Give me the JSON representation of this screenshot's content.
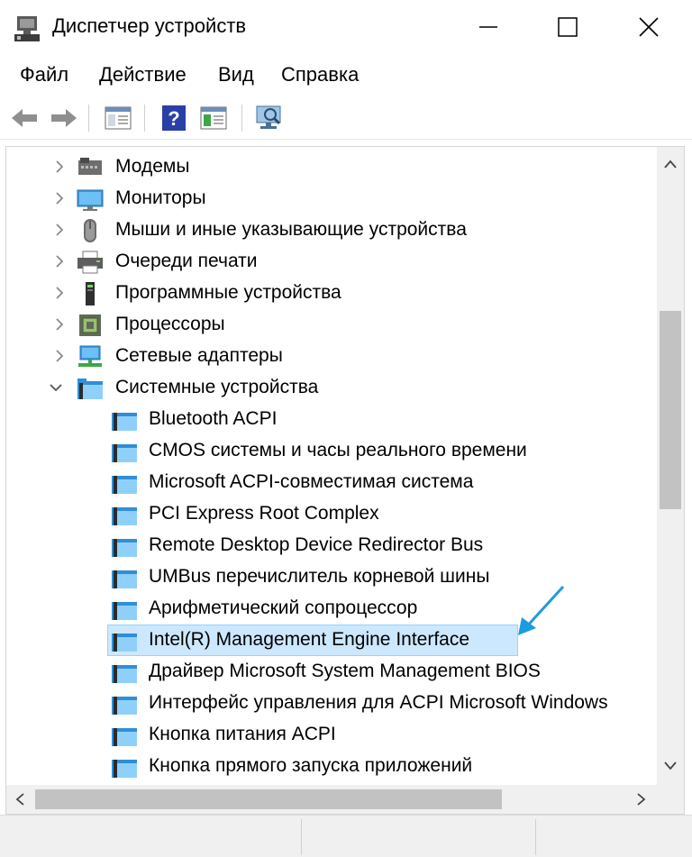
{
  "window": {
    "title": "Диспетчер устройств"
  },
  "menu": {
    "items": [
      "Файл",
      "Действие",
      "Вид",
      "Справка"
    ]
  },
  "toolbar": {
    "buttons": [
      "back-icon",
      "forward-icon",
      "show-hide-tree-icon",
      "help-icon",
      "properties-icon",
      "scan-hardware-icon"
    ]
  },
  "tree": {
    "categories": [
      {
        "label": "Модемы",
        "icon": "modem-icon",
        "expanded": false
      },
      {
        "label": "Мониторы",
        "icon": "monitor-icon",
        "expanded": false
      },
      {
        "label": "Мыши и иные указывающие устройства",
        "icon": "mouse-icon",
        "expanded": false
      },
      {
        "label": "Очереди печати",
        "icon": "printer-icon",
        "expanded": false
      },
      {
        "label": "Программные устройства",
        "icon": "software-device-icon",
        "expanded": false
      },
      {
        "label": "Процессоры",
        "icon": "processor-icon",
        "expanded": false
      },
      {
        "label": "Сетевые адаптеры",
        "icon": "network-adapter-icon",
        "expanded": false
      },
      {
        "label": "Системные устройства",
        "icon": "system-folder-icon",
        "expanded": true
      }
    ],
    "system_devices": [
      "Bluetooth ACPI",
      "CMOS системы и часы реального времени",
      "Microsoft ACPI-совместимая система",
      "PCI Express Root Complex",
      "Remote Desktop Device Redirector Bus",
      "UMBus перечислитель корневой шины",
      "Арифметический сопроцессор",
      "Intel(R) Management Engine Interface",
      "Драйвер Microsoft System Management BIOS",
      "Интерфейс управления для ACPI Microsoft Windows",
      "Кнопка питания ACPI",
      "Кнопка прямого запуска приложений"
    ],
    "selected": "Intel(R) Management Engine Interface"
  },
  "colors": {
    "accent_arrow": "#1e9be0",
    "selection_bg": "#cce8ff",
    "folder_blue": "#2f8fd8"
  }
}
